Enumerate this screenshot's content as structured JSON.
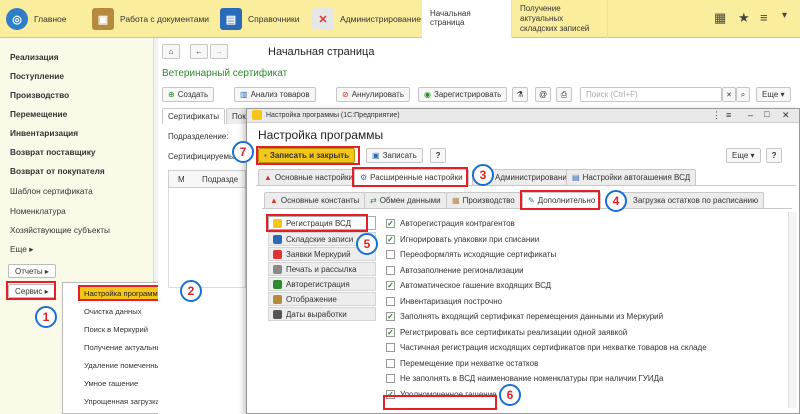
{
  "topbar": {
    "home": "Главное",
    "docs": "Работа с документами",
    "refs": "Справочники",
    "admin": "Администрирование",
    "tab_start": "Начальная страница",
    "tab_fetch": "Получение актуальных складских записей"
  },
  "sidebar": {
    "items": [
      "Реализация",
      "Поступление",
      "Производство",
      "Перемещение",
      "Инвентаризация",
      "Возврат поставщику",
      "Возврат от покупателя",
      "Шаблон сертификата",
      "Номенклатура",
      "Хозяйствующие субъекты",
      "Еще"
    ],
    "reports": "Отчеты",
    "service": "Сервис"
  },
  "popup": {
    "items": [
      "Настройка программы",
      "Очистка данных",
      "Поиск в Меркурий",
      "Получение актуальных складских записей",
      "Удаление помеченных объектов",
      "Умное гашение",
      "Упрощенная загрузка остатков"
    ]
  },
  "main": {
    "title": "Начальная страница",
    "subtitle": "Ветеринарный сертификат",
    "create": "Создать",
    "analyze": "Анализ товаров",
    "cancel": "Аннулировать",
    "register": "Зарегистрировать",
    "search_placeholder": "Поиск (Ctrl+F)",
    "more": "Еще",
    "tab_certs": "Сертификаты",
    "tab_cut": "Пока",
    "lbl_subdiv": "Подразделение:",
    "lbl_certified": "Сертифицируемы",
    "col_m": "М",
    "col_sender": "Подразде"
  },
  "dialog": {
    "window_title": "Настройка программы (1С:Предприятие)",
    "title": "Настройка программы",
    "save_close": "Записать и закрыть",
    "save": "Записать",
    "help": "?",
    "more": "Еще",
    "tabs": [
      "Основные настройки",
      "Расширенные настройки",
      "Администрирование",
      "Настройки автогашения ВСД"
    ],
    "subtabs": [
      "Основные константы",
      "Обмен данными",
      "Производство",
      "Дополнительно",
      "Загрузка остатков по расписанию"
    ],
    "left_nav": [
      "Регистрация ВСД",
      "Складские записи",
      "Заявки Меркурий",
      "Печать и рассылка",
      "Авторегистрация",
      "Отображение",
      "Даты выработки"
    ],
    "checks": [
      {
        "label": "Авторегистрация контрагентов",
        "checked": true
      },
      {
        "label": "Игнорировать упаковки при списании",
        "checked": true
      },
      {
        "label": "Переоформлять исходящие сертификаты",
        "checked": false
      },
      {
        "label": "Автозаполнение регионализации",
        "checked": false
      },
      {
        "label": "Автоматическое гашение входящих ВСД",
        "checked": true
      },
      {
        "label": "Инвентаризация построчно",
        "checked": false
      },
      {
        "label": "Заполнять входящий сертификат перемещения данными из Меркурий",
        "checked": true
      },
      {
        "label": "Регистрировать все сертификаты реализации одной заявкой",
        "checked": true
      },
      {
        "label": "Частичная регистрация исходящих сертификатов при нехватке товаров на складе",
        "checked": false
      },
      {
        "label": "Перемещение при нехватке остатков",
        "checked": false
      },
      {
        "label": "Не заполнять в ВСД наименование номенклатуры при наличии ГУИДа",
        "checked": false
      },
      {
        "label": "Уполномоченное гашение",
        "checked": true
      }
    ]
  },
  "badges": [
    "1",
    "2",
    "3",
    "4",
    "5",
    "6",
    "7"
  ],
  "colors": {
    "accent_yellow": "#fbed9e",
    "highlight": "#f3c617",
    "annotation_red": "#e3202a",
    "badge_blue": "#1a6fd6"
  }
}
